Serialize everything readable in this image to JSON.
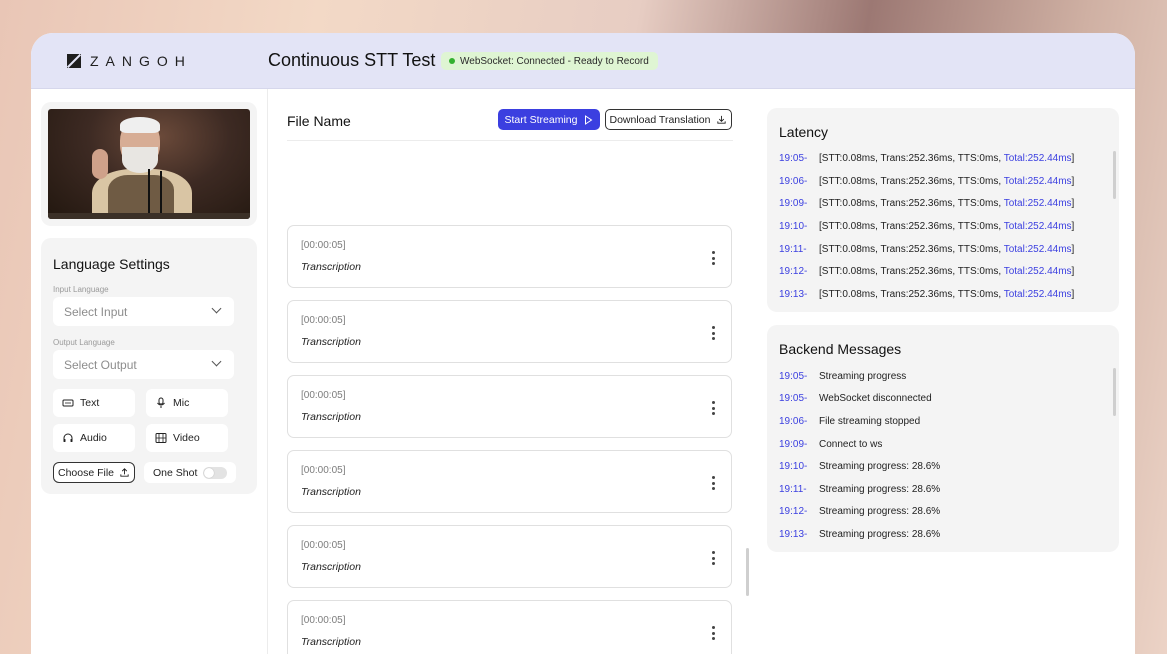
{
  "brand": {
    "logo_text": "ZANGOH"
  },
  "header": {
    "title": "Continuous STT Test",
    "status": "WebSocket: Connected - Ready to Record",
    "status_color": "#33b12f"
  },
  "language_settings": {
    "title": "Language Settings",
    "input_label": "Input Language",
    "input_placeholder": "Select Input",
    "output_label": "Output Language",
    "output_placeholder": "Select Output",
    "modes": [
      {
        "label": "Text",
        "icon": "keyboard-icon"
      },
      {
        "label": "Mic",
        "icon": "microphone-icon"
      },
      {
        "label": "Audio",
        "icon": "headphones-icon"
      },
      {
        "label": "Video",
        "icon": "film-icon"
      }
    ],
    "choose_file_label": "Choose File",
    "one_shot_label": "One Shot",
    "one_shot_enabled": false
  },
  "main": {
    "file_name_label": "File Name",
    "start_streaming_label": "Start Streaming",
    "download_label": "Download Translation",
    "accent_color": "#3b3fe0",
    "transcriptions": [
      {
        "time": "[00:00:05]",
        "text": "Transcription"
      },
      {
        "time": "[00:00:05]",
        "text": "Transcription"
      },
      {
        "time": "[00:00:05]",
        "text": "Transcription"
      },
      {
        "time": "[00:00:05]",
        "text": "Transcription"
      },
      {
        "time": "[00:00:05]",
        "text": "Transcription"
      },
      {
        "time": "[00:00:05]",
        "text": "Transcription"
      }
    ]
  },
  "latency": {
    "title": "Latency",
    "rows": [
      {
        "time": "19:05-",
        "detail": "[STT:0.08ms, Trans:252.36ms, TTS:0ms, ",
        "total": "Total:252.44ms",
        "close": "]"
      },
      {
        "time": "19:06-",
        "detail": "[STT:0.08ms, Trans:252.36ms, TTS:0ms, ",
        "total": "Total:252.44ms",
        "close": "]"
      },
      {
        "time": "19:09-",
        "detail": "[STT:0.08ms, Trans:252.36ms, TTS:0ms, ",
        "total": "Total:252.44ms",
        "close": "]"
      },
      {
        "time": "19:10-",
        "detail": "[STT:0.08ms, Trans:252.36ms, TTS:0ms, ",
        "total": "Total:252.44ms",
        "close": "]"
      },
      {
        "time": "19:11-",
        "detail": "[STT:0.08ms, Trans:252.36ms, TTS:0ms, ",
        "total": "Total:252.44ms",
        "close": "]"
      },
      {
        "time": "19:12-",
        "detail": "[STT:0.08ms, Trans:252.36ms, TTS:0ms, ",
        "total": "Total:252.44ms",
        "close": "]"
      },
      {
        "time": "19:13-",
        "detail": "[STT:0.08ms, Trans:252.36ms, TTS:0ms, ",
        "total": "Total:252.44ms",
        "close": "]"
      }
    ]
  },
  "backend": {
    "title": "Backend Messages",
    "rows": [
      {
        "time": "19:05-",
        "message": "Streaming progress"
      },
      {
        "time": "19:05-",
        "message": "WebSocket disconnected"
      },
      {
        "time": "19:06-",
        "message": "File streaming stopped"
      },
      {
        "time": "19:09-",
        "message": "Connect to ws"
      },
      {
        "time": "19:10-",
        "message": "Streaming progress: 28.6%"
      },
      {
        "time": "19:11-",
        "message": "Streaming progress: 28.6%"
      },
      {
        "time": "19:12-",
        "message": "Streaming progress: 28.6%"
      },
      {
        "time": "19:13-",
        "message": "Streaming progress: 28.6%"
      }
    ]
  }
}
